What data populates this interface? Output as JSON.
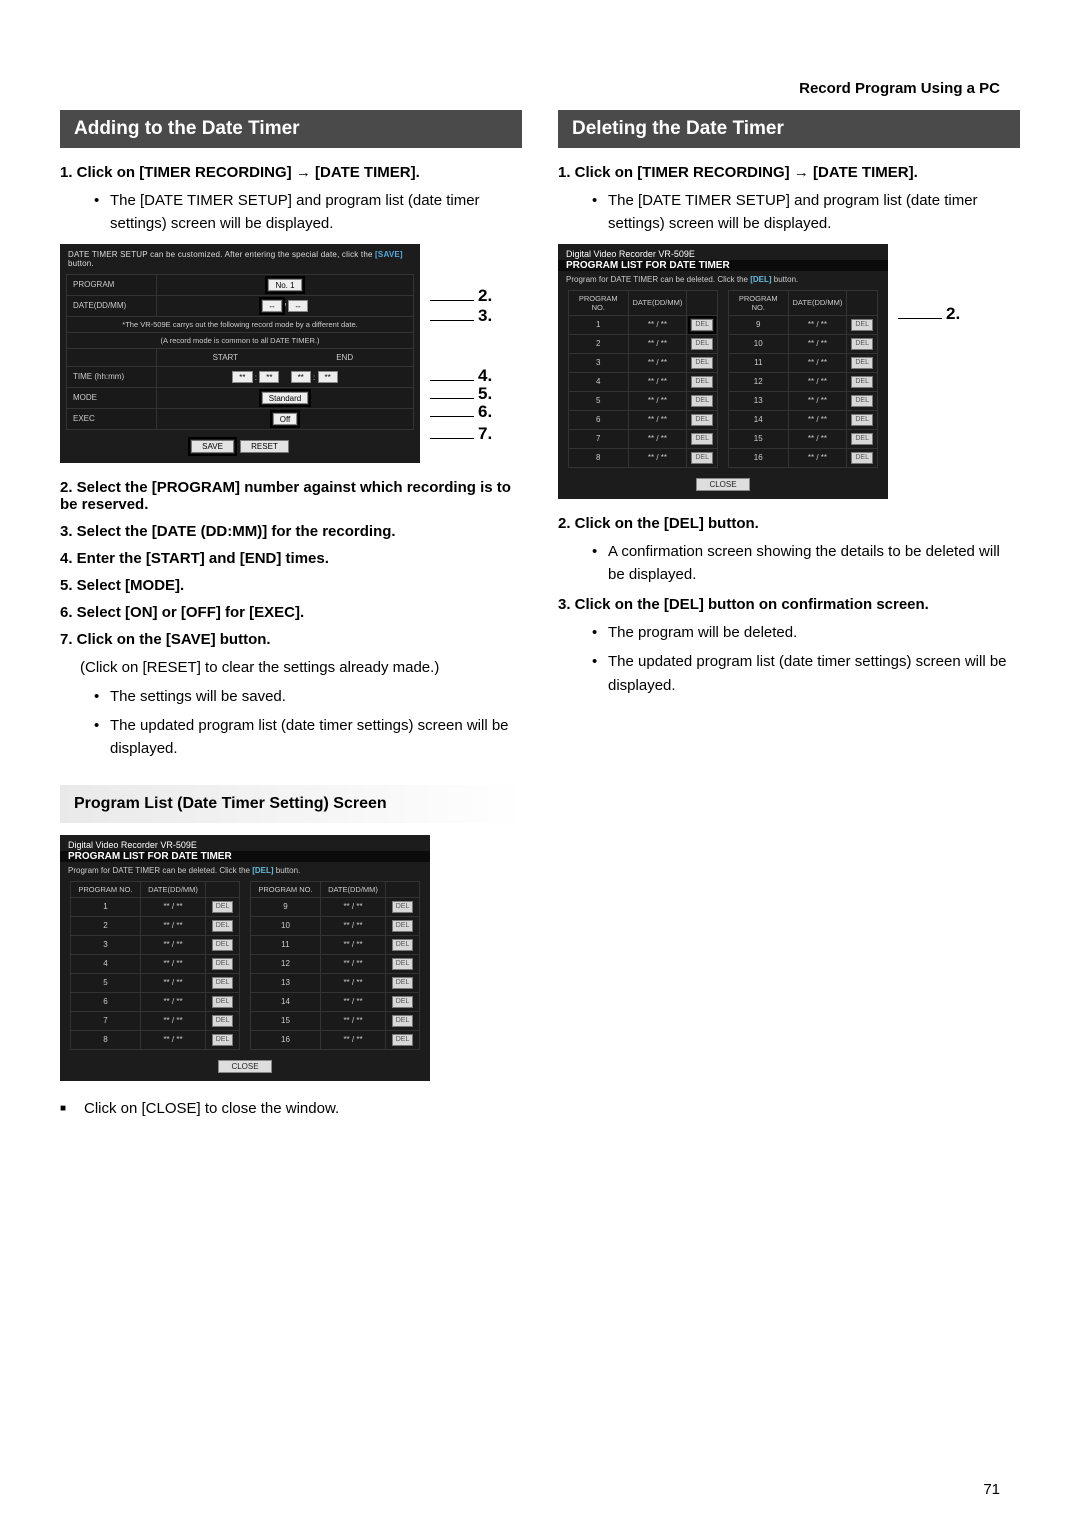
{
  "header": {
    "pageTitle": "Record Program Using a PC"
  },
  "pageNumber": "71",
  "left": {
    "sectionTitle": "Adding to the Date Timer",
    "step1_prefix": "1.  Click on [TIMER RECORDING] ",
    "step1_suffix": " [DATE TIMER].",
    "step1_bullet": "The [DATE TIMER SETUP] and program list (date timer settings) screen will be displayed.",
    "setupShot": {
      "caption_a": "DATE TIMER SETUP can be customized. After entering the special date, click the ",
      "caption_hl": "[SAVE]",
      "caption_b": " button.",
      "labels": {
        "program": "PROGRAM",
        "date": "DATE(DD/MM)",
        "time": "TIME (hh:mm)",
        "mode": "MODE",
        "exec": "EXEC",
        "start": "START",
        "end": "END"
      },
      "programSel": "No. 1",
      "dateSlash": "/",
      "note_a": "*The VR-509E carrys out the following record mode by a different date.",
      "note_b": "(A record mode is common to all DATE TIMER.)",
      "timeColon": ":",
      "modeSel": "Standard",
      "execSel": "Off",
      "saveBtn": "SAVE",
      "resetBtn": "RESET"
    },
    "callouts": {
      "2": "2.",
      "3": "3.",
      "4": "4.",
      "5": "5.",
      "6": "6.",
      "7": "7."
    },
    "step2": "2.  Select the [PROGRAM] number against which recording is to be reserved.",
    "step3": "3.  Select the [DATE (DD:MM)] for the recording.",
    "step4": "4.  Enter the [START] and [END] times.",
    "step5": "5.  Select [MODE].",
    "step6": "6.  Select [ON] or [OFF] for [EXEC].",
    "step7": "7.  Click on the [SAVE] button.",
    "step7_paren": "(Click on [RESET] to clear the settings already made.)",
    "step7_b1": "The settings will be saved.",
    "step7_b2": "The updated program list (date timer settings) screen will be displayed.",
    "subhead": "Program List (Date Timer Setting) Screen",
    "listShot": {
      "deviceTitle": "Digital Video Recorder VR-509E",
      "panelTitle": "PROGRAM LIST FOR DATE TIMER",
      "instr_a": "Program for DATE TIMER can be deleted. Click the ",
      "instr_hl": "[DEL]",
      "instr_b": " button.",
      "colProgram": "PROGRAM NO.",
      "colDate": "DATE(DD/MM)",
      "placeholder": "** / **",
      "delLabel": "DEL",
      "closeLabel": "CLOSE",
      "leftNums": [
        "1",
        "2",
        "3",
        "4",
        "5",
        "6",
        "7",
        "8"
      ],
      "rightNums": [
        "9",
        "10",
        "11",
        "12",
        "13",
        "14",
        "15",
        "16"
      ]
    },
    "closeNote": "Click on [CLOSE] to close the window."
  },
  "right": {
    "sectionTitle": "Deleting the Date Timer",
    "step1_prefix": "1.  Click on [TIMER RECORDING] ",
    "step1_suffix": " [DATE TIMER].",
    "step1_bullet": "The [DATE TIMER SETUP] and program list (date timer settings) screen will be displayed.",
    "callout2": "2.",
    "step2": "2.  Click on the [DEL] button.",
    "step2_b1": "A confirmation screen showing the details to be deleted will be displayed.",
    "step3": "3.  Click on the [DEL] button on confirmation screen.",
    "step3_b1": "The program will be deleted.",
    "step3_b2": "The updated program list (date timer settings) screen will be displayed."
  }
}
